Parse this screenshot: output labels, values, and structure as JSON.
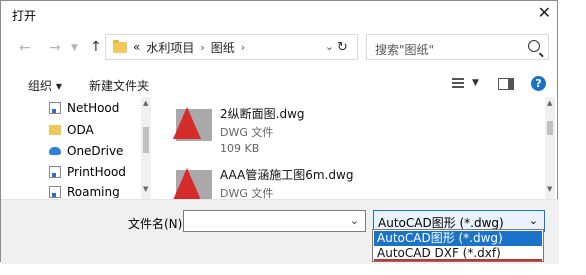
{
  "window": {
    "title": "打开",
    "close": "✕"
  },
  "nav": {
    "back": "←",
    "forward": "→",
    "up": "↑",
    "refresh": "↻"
  },
  "address": {
    "overflow": "«",
    "crumbs": [
      "水利项目",
      "图纸"
    ],
    "separator": "›",
    "dropdown": "⌄"
  },
  "search": {
    "placeholder": "搜索\"图纸\""
  },
  "toolbar": {
    "organize": "组织 ▾",
    "new_folder": "新建文件夹",
    "view_dropdown": "▼",
    "help": "?"
  },
  "sidebar": {
    "items": [
      {
        "label": "NetHood",
        "icon": "doc-icon"
      },
      {
        "label": "ODA",
        "icon": "folder-icon"
      },
      {
        "label": "OneDrive",
        "icon": "cloud-icon"
      },
      {
        "label": "PrintHood",
        "icon": "doc-icon"
      },
      {
        "label": "Roaming",
        "icon": "doc-icon"
      }
    ]
  },
  "files": [
    {
      "name": "2纵断面图.dwg",
      "type": "DWG 文件",
      "size": "109 KB"
    },
    {
      "name": "AAA管涵施工图6m.dwg",
      "type": "DWG 文件",
      "size": ""
    }
  ],
  "bottom": {
    "filename_label": "文件名(N):",
    "filename_value": "",
    "filetype_selected": "AutoCAD图形 (*.dwg)",
    "filetype_options": [
      "AutoCAD图形 (*.dwg)",
      "AutoCAD DXF (*.dxf)"
    ]
  }
}
